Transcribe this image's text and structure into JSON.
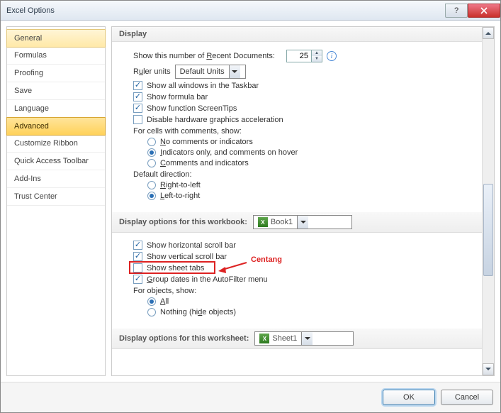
{
  "window": {
    "title": "Excel Options"
  },
  "sidebar": {
    "items": [
      {
        "label": "General"
      },
      {
        "label": "Formulas"
      },
      {
        "label": "Proofing"
      },
      {
        "label": "Save"
      },
      {
        "label": "Language"
      },
      {
        "label": "Advanced"
      },
      {
        "label": "Customize Ribbon"
      },
      {
        "label": "Quick Access Toolbar"
      },
      {
        "label": "Add-Ins"
      },
      {
        "label": "Trust Center"
      }
    ],
    "selected_index": 5
  },
  "display": {
    "header": "Display",
    "recent_label_a": "Show this number of ",
    "recent_label_b": "R",
    "recent_label_c": "ecent Documents:",
    "recent_value": "25",
    "ruler_label_a": "R",
    "ruler_label_b": "u",
    "ruler_label_c": "ler units",
    "ruler_value": "Default Units",
    "opt_windows_taskbar": "Show all windows in the Taskbar",
    "opt_formula_bar": "Show formula bar",
    "opt_screentips": "Show function ScreenTips",
    "opt_hw_accel_a": "Disable hardware ",
    "opt_hw_accel_b": "g",
    "opt_hw_accel_c": "raphics acceleration",
    "comments_header": "For cells with comments, show:",
    "comments_none_a": "N",
    "comments_none_b": "o comments or indicators",
    "comments_ind_a": "I",
    "comments_ind_b": "ndicators only, and comments on hover",
    "comments_both_a": "C",
    "comments_both_b": "omments and indicators",
    "dir_header": "Default direction:",
    "dir_rtl_a": "R",
    "dir_rtl_b": "ight-to-left",
    "dir_ltr_a": "L",
    "dir_ltr_b": "eft-to-right"
  },
  "workbook": {
    "header": "Display options for this workbook:",
    "value": "Book1",
    "h_scroll": "Show horizontal scroll bar",
    "v_scroll": "Show vertical scroll bar",
    "sheet_tabs": "Show sheet tabs",
    "group_dates_a": "G",
    "group_dates_b": "roup dates in the AutoFilter menu",
    "objects_header": "For objects, show:",
    "obj_all_a": "A",
    "obj_all_b": "ll",
    "obj_none_a": "Nothing (hi",
    "obj_none_b": "d",
    "obj_none_c": "e objects)"
  },
  "worksheet": {
    "header": "Display options for this worksheet:",
    "value": "Sheet1"
  },
  "footer": {
    "ok": "OK",
    "cancel": "Cancel"
  },
  "annotation": {
    "text": "Centang"
  }
}
